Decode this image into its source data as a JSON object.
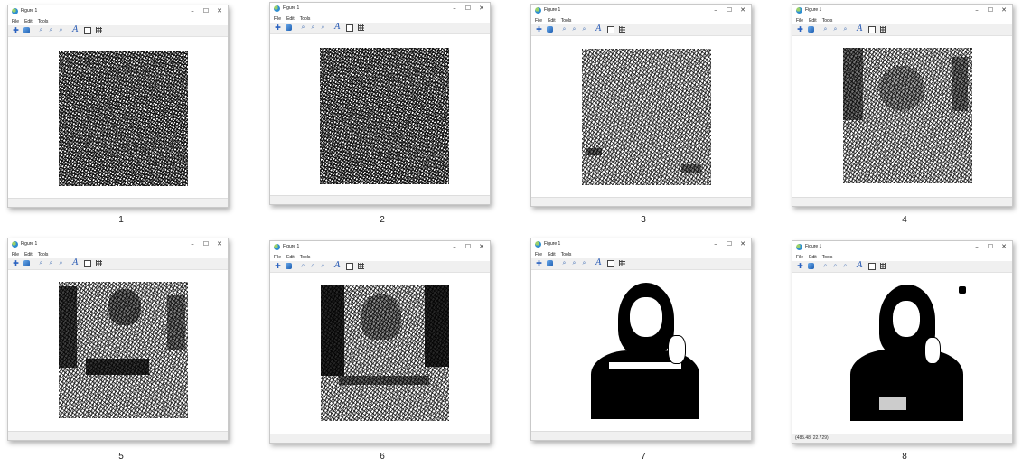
{
  "window": {
    "title": "Figure 1",
    "controls": {
      "minimize": "–",
      "maximize": "☐",
      "close": "✕"
    },
    "menu": [
      "File",
      "Edit",
      "Tools"
    ],
    "toolbar_icons": [
      "pan-icon",
      "rotate-icon",
      "zoom-in-icon",
      "zoom-out-icon",
      "zoom-reset-icon",
      "text-icon",
      "rectangle-icon",
      "grid-icon"
    ]
  },
  "panels": [
    {
      "caption": "1",
      "status": ""
    },
    {
      "caption": "2",
      "status": ""
    },
    {
      "caption": "3",
      "status": ""
    },
    {
      "caption": "4",
      "status": ""
    },
    {
      "caption": "5",
      "status": ""
    },
    {
      "caption": "6",
      "status": ""
    },
    {
      "caption": "7",
      "status": ""
    },
    {
      "caption": "8",
      "status": "(485.48, 22.729)"
    }
  ]
}
